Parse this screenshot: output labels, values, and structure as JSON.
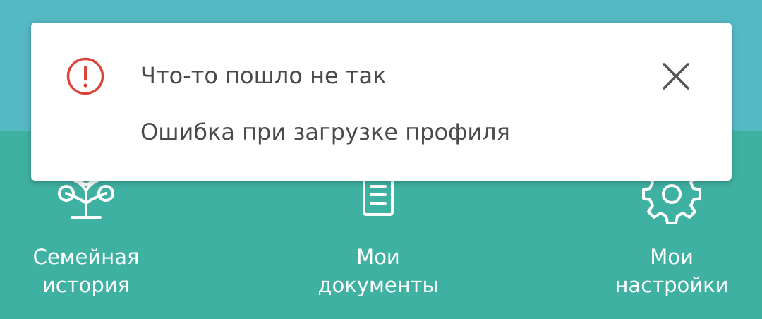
{
  "toast": {
    "title": "Что-то пошло не так",
    "message": "Ошибка при загрузке профиля",
    "icon": "alert-circle-icon",
    "close_icon": "close-icon",
    "accent_color": "#d9453b"
  },
  "nav": {
    "items": [
      {
        "label": "Семейная\nистория",
        "icon": "family-tree-icon"
      },
      {
        "label": "Мои\nдокументы",
        "icon": "document-icon"
      },
      {
        "label": "Мои\nнастройки",
        "icon": "gear-icon"
      }
    ]
  },
  "colors": {
    "header_band": "#55b9c4",
    "nav_band": "#3fb1a2",
    "toast_bg": "#ffffff",
    "text": "#4a4a4a"
  }
}
